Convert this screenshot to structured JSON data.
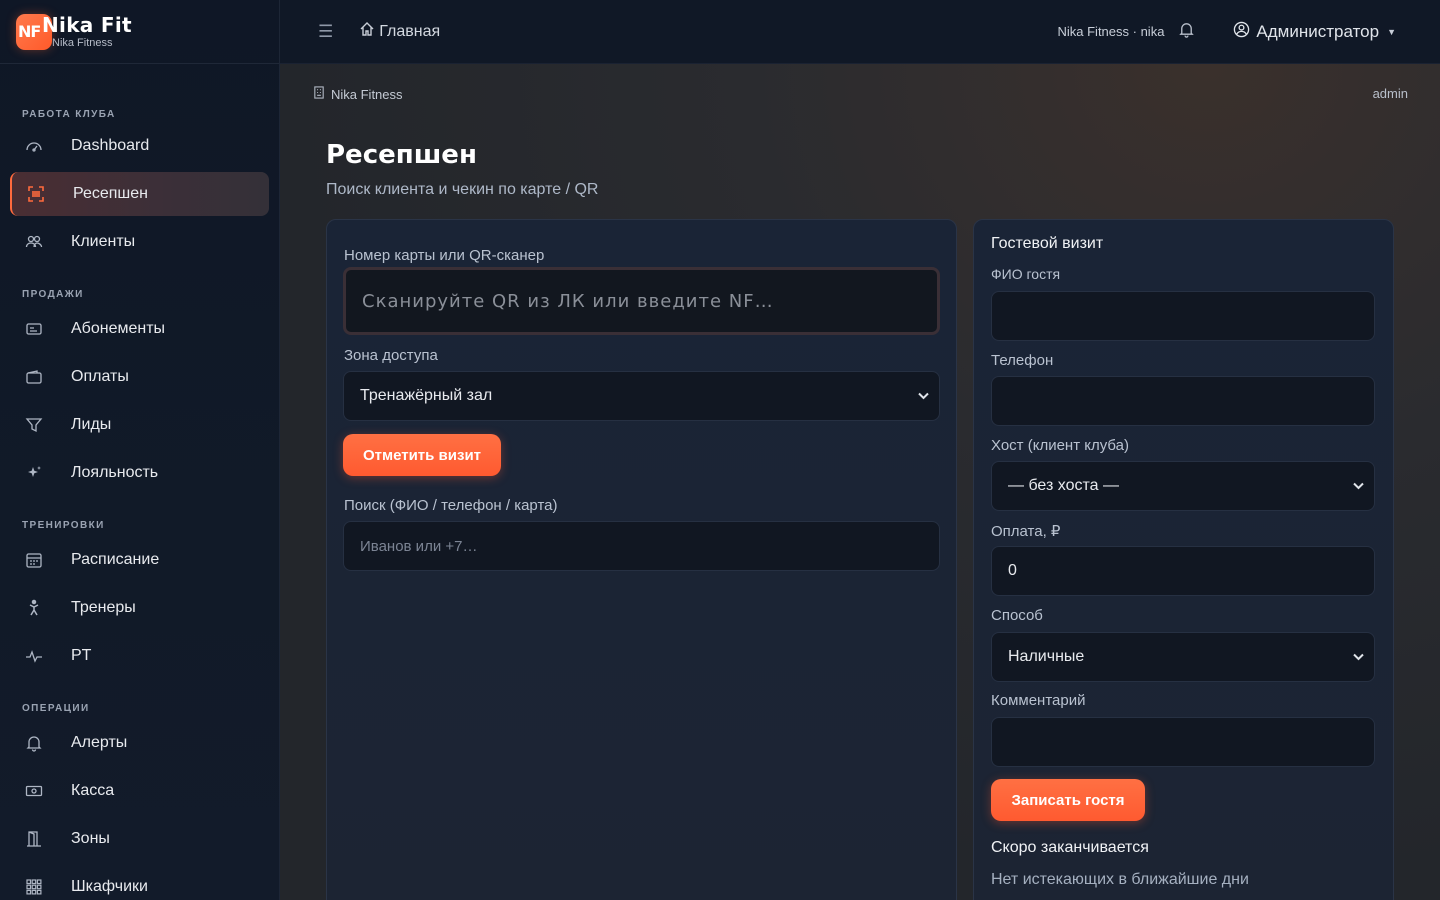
{
  "brand": {
    "logo_text": "NF",
    "title": "Nika Fit",
    "subtitle": "Nika Fitness"
  },
  "sidebar": {
    "sections": [
      {
        "title": "РАБОТА КЛУБА",
        "items": [
          {
            "label": "Dashboard",
            "icon": "gauge-icon"
          },
          {
            "label": "Ресепшен",
            "icon": "scan-icon",
            "active": true
          },
          {
            "label": "Клиенты",
            "icon": "people-icon"
          }
        ]
      },
      {
        "title": "ПРОДАЖИ",
        "items": [
          {
            "label": "Абонементы",
            "icon": "card-icon"
          },
          {
            "label": "Оплаты",
            "icon": "wallet-icon"
          },
          {
            "label": "Лиды",
            "icon": "funnel-icon"
          },
          {
            "label": "Лояльность",
            "icon": "sparkle-icon"
          }
        ]
      },
      {
        "title": "ТРЕНИРОВКИ",
        "items": [
          {
            "label": "Расписание",
            "icon": "calendar-icon"
          },
          {
            "label": "Тренеры",
            "icon": "person-icon"
          },
          {
            "label": "PT",
            "icon": "pulse-icon"
          }
        ]
      },
      {
        "title": "ОПЕРАЦИИ",
        "items": [
          {
            "label": "Алерты",
            "icon": "bell-icon"
          },
          {
            "label": "Касса",
            "icon": "cash-icon"
          },
          {
            "label": "Зоны",
            "icon": "door-icon"
          },
          {
            "label": "Шкафчики",
            "icon": "grid-icon"
          }
        ]
      }
    ]
  },
  "topbar": {
    "home_label": "Главная",
    "org_label": "Nika Fitness · nika",
    "user_label": "Администратор"
  },
  "breadcrumb": {
    "label": "Nika Fitness"
  },
  "admin_tag": "admin",
  "page": {
    "title": "Ресепшен",
    "subtitle": "Поиск клиента и чекин по карте / QR"
  },
  "checkin": {
    "card_label": "Номер карты или QR-сканер",
    "card_placeholder": "Сканируйте QR из ЛК или введите NF…",
    "zone_label": "Зона доступа",
    "zone_value": "Тренажёрный зал",
    "visit_button": "Отметить визит",
    "search_label": "Поиск (ФИО / телефон / карта)",
    "search_placeholder": "Иванов или +7…"
  },
  "guest": {
    "title": "Гостевой визит",
    "name_label": "ФИО гостя",
    "phone_label": "Телефон",
    "host_label": "Хост (клиент клуба)",
    "host_value": "— без хоста —",
    "payment_label": "Оплата, ₽",
    "payment_value": "0",
    "method_label": "Способ",
    "method_value": "Наличные",
    "comment_label": "Комментарий",
    "submit_button": "Записать гостя",
    "expiring_title": "Скоро заканчивается",
    "expiring_note": "Нет истекающих в ближайшие дни"
  },
  "colors": {
    "accent": "#ff6a3d",
    "sidebar_bg": "#0f1726",
    "card_bg": "#1a2436"
  }
}
